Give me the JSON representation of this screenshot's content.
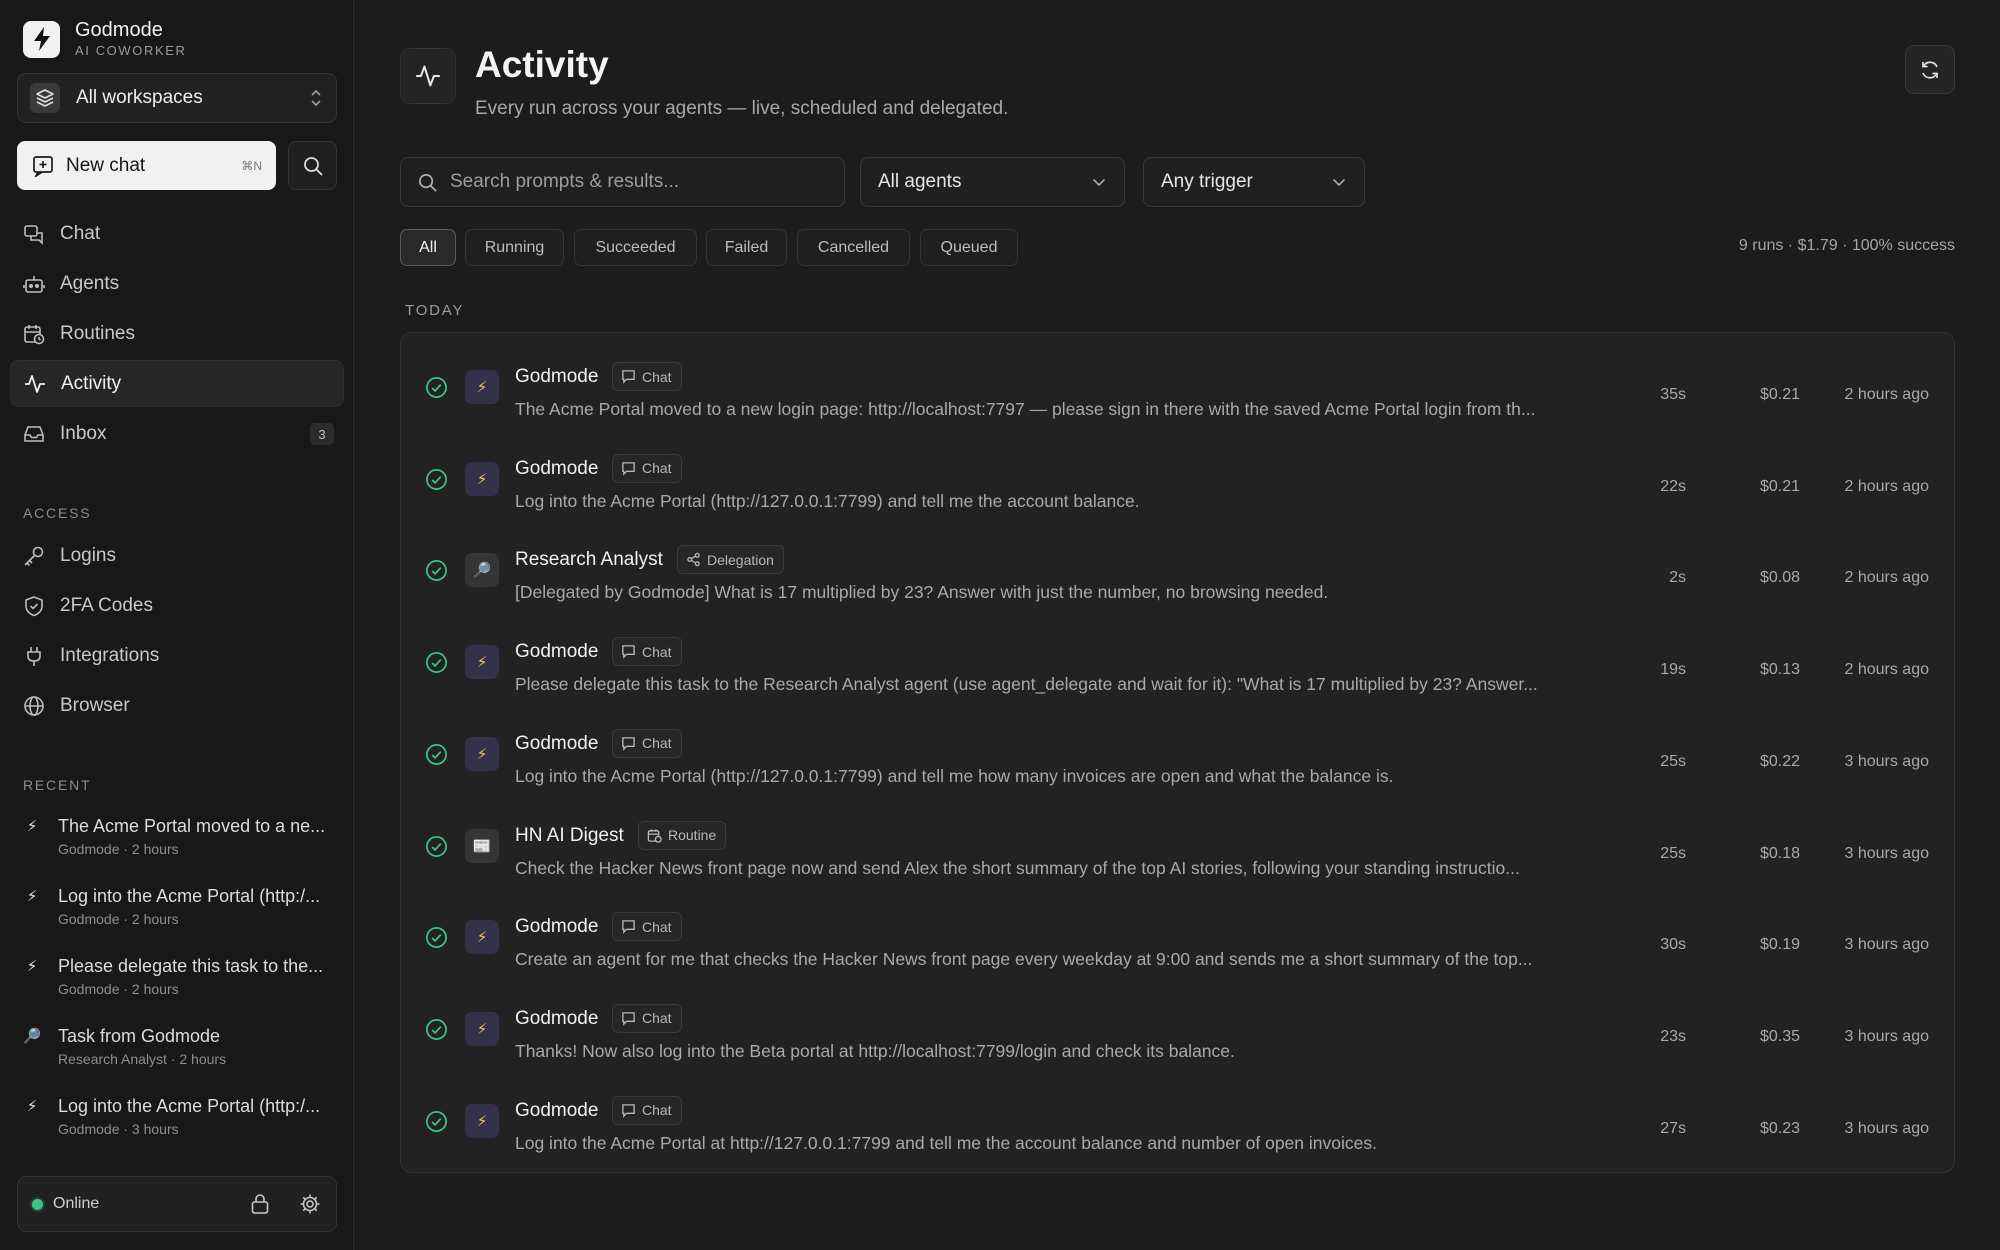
{
  "app": {
    "name": "Godmode",
    "subtitle": "AI COWORKER"
  },
  "workspace": {
    "label": "All workspaces"
  },
  "new_chat": {
    "label": "New chat",
    "shortcut": "⌘N"
  },
  "nav": [
    {
      "label": "Chat",
      "icon": "chat-icon"
    },
    {
      "label": "Agents",
      "icon": "robot-icon"
    },
    {
      "label": "Routines",
      "icon": "calendar-clock-icon"
    },
    {
      "label": "Activity",
      "icon": "activity-icon",
      "active": true
    },
    {
      "label": "Inbox",
      "icon": "inbox-icon",
      "badge": "3"
    }
  ],
  "access": {
    "label": "ACCESS",
    "items": [
      {
        "label": "Logins",
        "icon": "key-icon"
      },
      {
        "label": "2FA Codes",
        "icon": "shield-icon"
      },
      {
        "label": "Integrations",
        "icon": "plug-icon"
      },
      {
        "label": "Browser",
        "icon": "globe-icon"
      }
    ]
  },
  "recent": {
    "label": "RECENT",
    "items": [
      {
        "title": "The Acme Portal moved to a ne...",
        "meta": "Godmode · 2 hours",
        "icon": "⚡"
      },
      {
        "title": "Log into the Acme Portal (http:/...",
        "meta": "Godmode · 2 hours",
        "icon": "⚡"
      },
      {
        "title": "Please delegate this task to the...",
        "meta": "Godmode · 2 hours",
        "icon": "⚡"
      },
      {
        "title": "Task from Godmode",
        "meta": "Research Analyst · 2 hours",
        "icon": "🔎"
      },
      {
        "title": "Log into the Acme Portal (http:/...",
        "meta": "Godmode · 3 hours",
        "icon": "⚡"
      }
    ]
  },
  "status": {
    "label": "Online",
    "color": "#3ec38a"
  },
  "page": {
    "title": "Activity",
    "subtitle": "Every run across your agents — live, scheduled and delegated."
  },
  "filters": {
    "search_placeholder": "Search prompts & results...",
    "agent": "All agents",
    "trigger": "Any trigger",
    "chips": [
      "All",
      "Running",
      "Succeeded",
      "Failed",
      "Cancelled",
      "Queued"
    ],
    "active_chip": "All"
  },
  "summary": "9 runs · $1.79 · 100% success",
  "group_label": "TODAY",
  "runs": [
    {
      "agent": "Godmode",
      "icon": "⚡",
      "tag": "Chat",
      "prompt": "The Acme Portal moved to a new login page: http://localhost:7797 — please sign in there with the saved Acme Portal login from th...",
      "duration": "35s",
      "cost": "$0.21",
      "time": "2 hours ago",
      "status": "succeeded"
    },
    {
      "agent": "Godmode",
      "icon": "⚡",
      "tag": "Chat",
      "prompt": "Log into the Acme Portal (http://127.0.0.1:7799) and tell me the account balance.",
      "duration": "22s",
      "cost": "$0.21",
      "time": "2 hours ago",
      "status": "succeeded"
    },
    {
      "agent": "Research Analyst",
      "icon": "🔎",
      "tag": "Delegation",
      "prompt": "[Delegated by Godmode] What is 17 multiplied by 23? Answer with just the number, no browsing needed.",
      "duration": "2s",
      "cost": "$0.08",
      "time": "2 hours ago",
      "status": "succeeded"
    },
    {
      "agent": "Godmode",
      "icon": "⚡",
      "tag": "Chat",
      "prompt": "Please delegate this task to the Research Analyst agent (use agent_delegate and wait for it): \"What is 17 multiplied by 23? Answer...",
      "duration": "19s",
      "cost": "$0.13",
      "time": "2 hours ago",
      "status": "succeeded"
    },
    {
      "agent": "Godmode",
      "icon": "⚡",
      "tag": "Chat",
      "prompt": "Log into the Acme Portal (http://127.0.0.1:7799) and tell me how many invoices are open and what the balance is.",
      "duration": "25s",
      "cost": "$0.22",
      "time": "3 hours ago",
      "status": "succeeded"
    },
    {
      "agent": "HN AI Digest",
      "icon": "📰",
      "tag": "Routine",
      "prompt": "Check the Hacker News front page now and send Alex the short summary of the top AI stories, following your standing instructio...",
      "duration": "25s",
      "cost": "$0.18",
      "time": "3 hours ago",
      "status": "succeeded"
    },
    {
      "agent": "Godmode",
      "icon": "⚡",
      "tag": "Chat",
      "prompt": "Create an agent for me that checks the Hacker News front page every weekday at 9:00 and sends me a short summary of the top...",
      "duration": "30s",
      "cost": "$0.19",
      "time": "3 hours ago",
      "status": "succeeded"
    },
    {
      "agent": "Godmode",
      "icon": "⚡",
      "tag": "Chat",
      "prompt": "Thanks! Now also log into the Beta portal at http://localhost:7799/login and check its balance.",
      "duration": "23s",
      "cost": "$0.35",
      "time": "3 hours ago",
      "status": "succeeded"
    },
    {
      "agent": "Godmode",
      "icon": "⚡",
      "tag": "Chat",
      "prompt": "Log into the Acme Portal at http://127.0.0.1:7799 and tell me the account balance and number of open invoices.",
      "duration": "27s",
      "cost": "$0.23",
      "time": "3 hours ago",
      "status": "succeeded"
    }
  ],
  "colors": {
    "success": "#3ec38a",
    "accent": "#f2c94c",
    "background": "#1c1c1c"
  }
}
